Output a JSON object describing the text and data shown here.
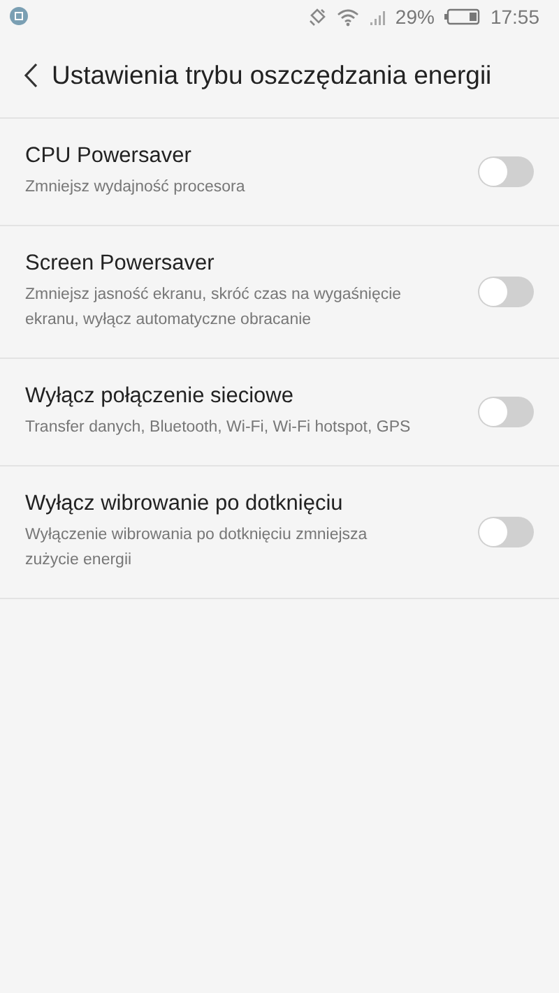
{
  "status_bar": {
    "battery_percent": "29%",
    "time": "17:55"
  },
  "header": {
    "title": "Ustawienia trybu oszczędzania energii"
  },
  "settings": [
    {
      "title": "CPU Powersaver",
      "description": "Zmniejsz wydajność procesora",
      "on": false
    },
    {
      "title": "Screen Powersaver",
      "description": "Zmniejsz jasność ekranu, skróć czas na wygaśnięcie ekranu, wyłącz automatyczne obracanie",
      "on": false
    },
    {
      "title": "Wyłącz połączenie sieciowe",
      "description": "Transfer danych, Bluetooth, Wi-Fi, Wi-Fi hotspot, GPS",
      "on": false
    },
    {
      "title": "Wyłącz wibrowanie po dotknięciu",
      "description": "Wyłączenie wibrowania po dotknięciu zmniejsza zużycie energii",
      "on": false
    }
  ]
}
